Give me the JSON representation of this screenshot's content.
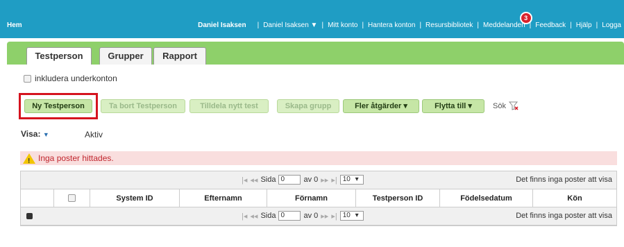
{
  "topbar": {
    "home": "Hem",
    "user_bold": "Daniel Isaksen",
    "links": [
      "Daniel Isaksen ▼",
      "Mitt konto",
      "Hantera konton",
      "Resursbibliotek",
      "Meddelanden",
      "Feedback",
      "Hjälp",
      "Logga"
    ],
    "message_count": "3"
  },
  "tabs": [
    "Testperson",
    "Grupper",
    "Rapport"
  ],
  "include_label": "inkludera underkonton",
  "toolbar": {
    "ny": "Ny Testperson",
    "ta_bort": "Ta bort Testperson",
    "tilldela": "Tilldela nytt test",
    "skapa": "Skapa grupp",
    "fler": "Fler åtgärder",
    "flytta": "Flytta till",
    "sok": "Sök"
  },
  "visa": {
    "label": "Visa:",
    "value": "Aktiv"
  },
  "alert": "Inga poster hittades.",
  "pager": {
    "sida": "Sida",
    "page": "0",
    "av": "av 0",
    "per_page": "10",
    "info": "Det finns inga poster att visa"
  },
  "columns": [
    "System ID",
    "Efternamn",
    "Förnamn",
    "Testperson ID",
    "Födelsedatum",
    "Kön"
  ],
  "colors": {
    "topbar": "#1f9dc4",
    "tabband": "#8ed06a",
    "highlight": "#d5141f"
  }
}
